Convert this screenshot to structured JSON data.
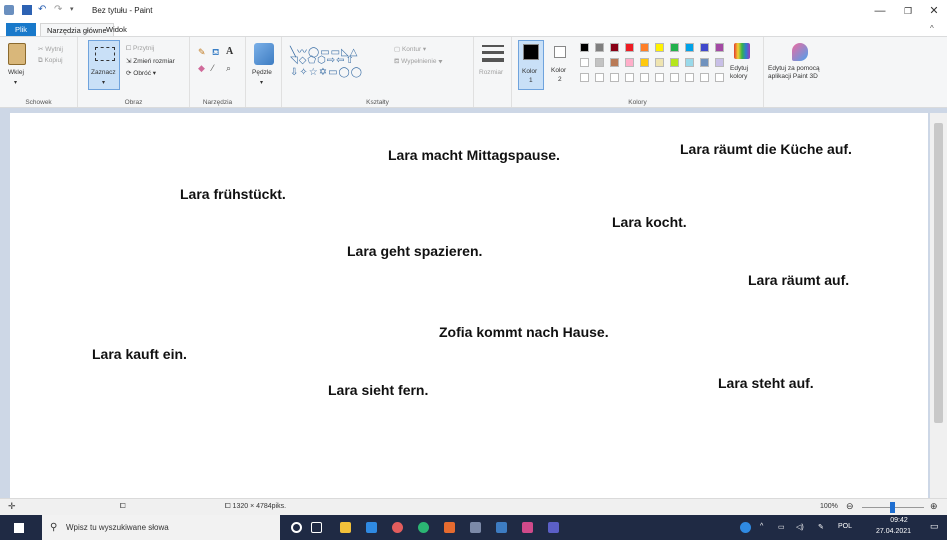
{
  "window": {
    "title": "Bez tytułu - Paint"
  },
  "tabs": [
    "Plik",
    "Narzędzia główne",
    "Widok"
  ],
  "ribbon": {
    "clipboard": {
      "paste": "Wklej",
      "cut": "Wytnij",
      "copy": "Kopiuj",
      "group": "Schowek"
    },
    "image": {
      "select": "Zaznacz",
      "crop": "Przytnij",
      "resize": "Zmień rozmiar",
      "rotate": "Obróć",
      "group": "Obraz"
    },
    "tools": {
      "group": "Narzędzia"
    },
    "brushes": {
      "label": "Pędzle"
    },
    "shapes": {
      "outline": "Kontur",
      "fill": "Wypełnienie",
      "group": "Kształty"
    },
    "size": {
      "label": "Rozmiar"
    },
    "colors": {
      "color1": "Kolor",
      "color1_num": "1",
      "color2": "Kolor",
      "color2_num": "2",
      "edit": "Edytuj",
      "edit2": "kolory",
      "paint3d": "Edytuj za pomocą",
      "paint3d2": "aplikacji Paint 3D",
      "group": "Kolory",
      "palette_row1": [
        "#000000",
        "#7f7f7f",
        "#880015",
        "#ed1c24",
        "#ff7f27",
        "#fff200",
        "#22b14c",
        "#00a2e8",
        "#3f48cc",
        "#a349a4"
      ],
      "palette_row2": [
        "#ffffff",
        "#c3c3c3",
        "#b97a57",
        "#ffaec9",
        "#ffc90e",
        "#efe4b0",
        "#b5e61d",
        "#99d9ea",
        "#7092be",
        "#c8bfe7"
      ]
    }
  },
  "canvas_texts": [
    "Lara macht Mittagspause.",
    "Lara räumt die Küche auf.",
    "Lara frühstückt.",
    "Lara kocht.",
    "Lara geht spazieren.",
    "Lara räumt auf.",
    "Zofia kommt nach Hause.",
    "Lara kauft ein.",
    "Lara sieht fern.",
    "Lara steht auf."
  ],
  "status": {
    "size": "1320 × 4784piks.",
    "zoom": "100%"
  },
  "taskbar": {
    "search_placeholder": "Wpisz tu wyszukiwane słowa",
    "lang": "POL",
    "time": "09:42",
    "date": "27.04.2021"
  }
}
